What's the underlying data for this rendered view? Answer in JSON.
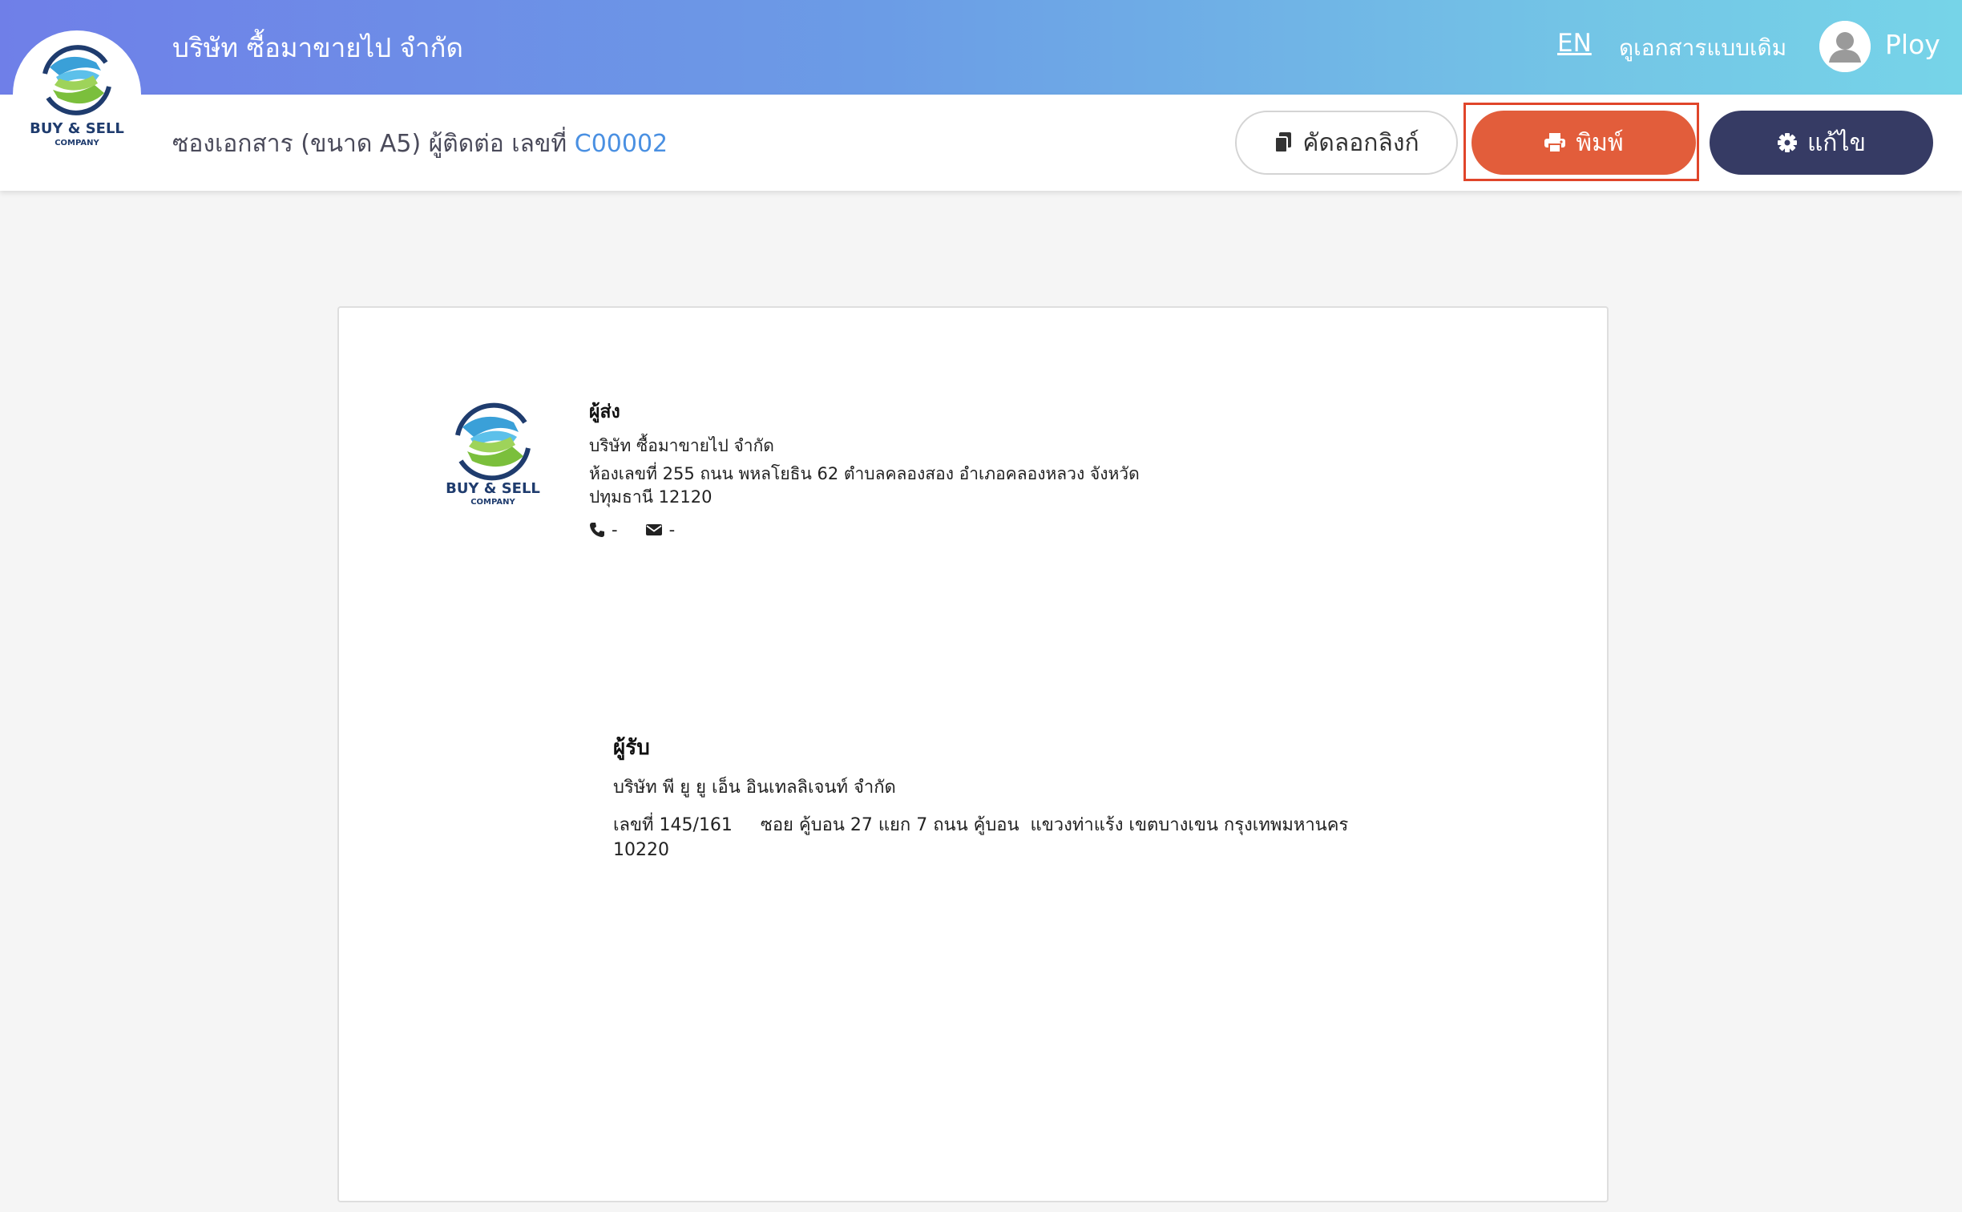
{
  "header": {
    "company_name": "บริษัท ซื้อมาขายไป จำกัด",
    "language_toggle": "EN",
    "legacy_view_link": "ดูเอกสารแบบเดิม",
    "user_name": "Ploy"
  },
  "logo": {
    "line1": "BUY & SELL",
    "line2": "COMPANY"
  },
  "toolbar": {
    "title_prefix": "ซองเอกสาร (ขนาด A5) ผู้ติดต่อ เลขที่ ",
    "document_number": "C00002",
    "copy_link_label": "คัดลอกลิงก์",
    "print_label": "พิมพ์",
    "edit_label": "แก้ไข"
  },
  "envelope": {
    "sender": {
      "heading": "ผู้ส่ง",
      "name": "บริษัท ซื้อมาขายไป จำกัด",
      "address_line1": "ห้องเลขที่ 255 ถนน พหลโยธิน 62 ตำบลคลองสอง อำเภอคลองหลวง จังหวัด",
      "address_line2": "ปทุมธานี 12120",
      "phone": "-",
      "email": "-"
    },
    "recipient": {
      "heading": "ผู้รับ",
      "name": "บริษัท พี ยู ยู เอ็น อินเทลลิเจนท์ จำกัด",
      "address_line1": "เลขที่ 145/161     ซอย คู้บอน 27 แยก 7 ถนน คู้บอน  แขวงท่าแร้ง เขตบางเขน กรุงเทพมหานคร",
      "address_line2": "10220"
    }
  },
  "colors": {
    "header_gradient_start": "#6f7fe8",
    "header_gradient_end": "#76d4e8",
    "print_button": "#e25d3b",
    "edit_button": "#363b64",
    "document_number": "#4a90e2"
  }
}
